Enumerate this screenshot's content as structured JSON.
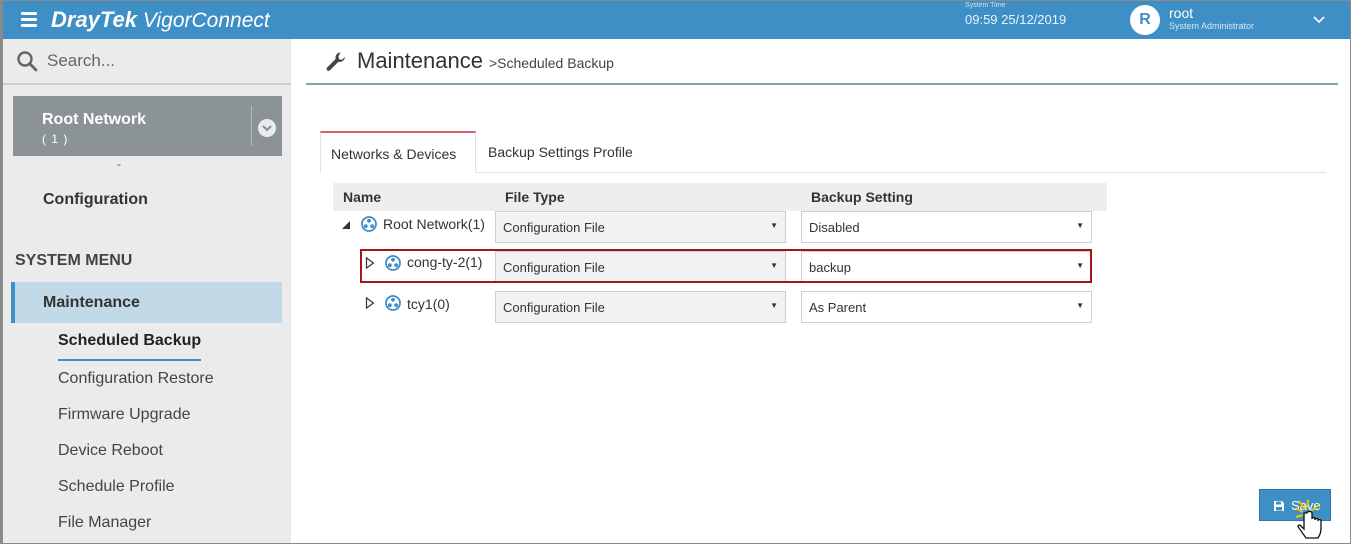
{
  "header": {
    "brand_bold": "DrayTek",
    "brand_rest": "VigorConnect",
    "system_time_label": "System Time",
    "system_time": "09:59 25/12/2019",
    "user_initial": "R",
    "user_name": "root",
    "user_role": "System Administrator",
    "accent_color": "#3d8fc6"
  },
  "sidebar": {
    "search_placeholder": "Search...",
    "network_name": "Root Network",
    "network_count": "( 1 )",
    "dash": "-",
    "configuration": "Configuration",
    "system_menu": "SYSTEM MENU",
    "maintenance": "Maintenance",
    "items": [
      {
        "label": "Scheduled Backup",
        "active": true
      },
      {
        "label": "Configuration Restore"
      },
      {
        "label": "Firmware Upgrade"
      },
      {
        "label": "Device Reboot"
      },
      {
        "label": "Schedule Profile"
      },
      {
        "label": "File Manager"
      }
    ]
  },
  "page": {
    "title": "Maintenance",
    "breadcrumb": ">Scheduled Backup"
  },
  "tabs": [
    {
      "label": "Networks & Devices",
      "active": true
    },
    {
      "label": "Backup Settings Profile"
    }
  ],
  "table": {
    "columns": [
      "Name",
      "File Type",
      "Backup Setting"
    ],
    "rows": [
      {
        "name": "Root Network(1)",
        "file_type": "Configuration File",
        "backup_setting": "Disabled"
      },
      {
        "name": "cong-ty-2(1)",
        "file_type": "Configuration File",
        "backup_setting": "backup"
      },
      {
        "name": "tcy1(0)",
        "file_type": "Configuration File",
        "backup_setting": "As Parent"
      }
    ]
  },
  "save_label": "Save"
}
